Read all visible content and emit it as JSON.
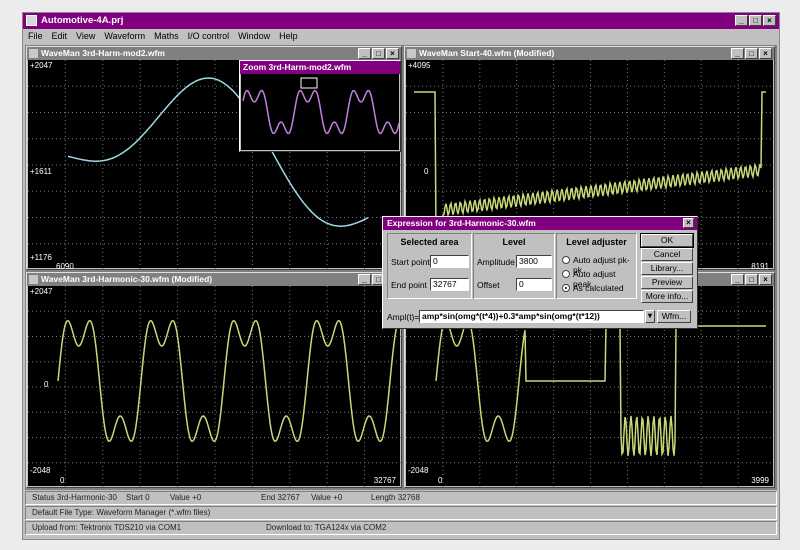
{
  "app": {
    "title": "Automotive-4A.prj"
  },
  "window_buttons": {
    "min": "_",
    "max": "□",
    "close": "×"
  },
  "menu": [
    "File",
    "Edit",
    "View",
    "Waveform",
    "Maths",
    "I/O control",
    "Window",
    "Help"
  ],
  "windows": {
    "w1": {
      "title": "WaveMan 3rd-Harm-mod2.wfm",
      "ytop": "+2047",
      "ymid": "+1611",
      "ybot": "+1176",
      "xleft": "6090",
      "trace_color": "#9fd8e8"
    },
    "w2": {
      "title": "WaveMan Start-40.wfm (Modified)",
      "ytop": "+4095",
      "ymid": "0",
      "xright": "8191",
      "trace_color": "#c8d878"
    },
    "w3": {
      "title": "WaveMan 3rd-Harmonic-30.wfm (Modified)",
      "ytop": "+2047",
      "ymid": "0",
      "ybot": "-2048",
      "xleft": "0",
      "xright": "32767",
      "trace_color": "#c8d878"
    },
    "w4": {
      "ybot": "-2048",
      "xleft": "0",
      "xright": "3999",
      "trace_color": "#c8d878"
    },
    "zoom": {
      "title": "Zoom 3rd-Harm-mod2.wfm",
      "trace_color": "#c080e0"
    }
  },
  "dialog": {
    "title": "Expression for 3rd-Harmonic-30.wfm",
    "selected_area": {
      "header": "Selected area",
      "start_label": "Start point",
      "start_value": "0",
      "end_label": "End point",
      "end_value": "32767"
    },
    "level": {
      "header": "Level",
      "amp_label": "Amplitude",
      "amp_value": "3800",
      "offset_label": "Offset",
      "offset_value": "0"
    },
    "level_adjuster": {
      "header": "Level adjuster",
      "options": [
        "Auto adjust pk-pk",
        "Auto adjust peak",
        "As calculated"
      ],
      "selected": "As calculated"
    },
    "buttons": {
      "ok": "OK",
      "cancel": "Cancel",
      "library": "Library...",
      "preview": "Preview",
      "more": "More info..."
    },
    "expr_label": "Ampl(t)=",
    "expr_value": "amp*sin(omg*(t*4))+0.3*amp*sin(omg*(t*12))",
    "wfm_button": "Wfm..."
  },
  "status": {
    "line1": {
      "status": "Status 3rd-Harmonic-30",
      "start": "Start 0",
      "value1": "Value +0",
      "end": "End 32767",
      "value2": "Value +0",
      "length": "Length 32768"
    },
    "line2": {
      "text": "Default File Type:   Waveform Manager (*.wfm files)"
    },
    "line3": {
      "upload": "Upload from:   Tektronix TDS210 via COM1",
      "download": "Download to:          TGA124x via COM2"
    }
  }
}
